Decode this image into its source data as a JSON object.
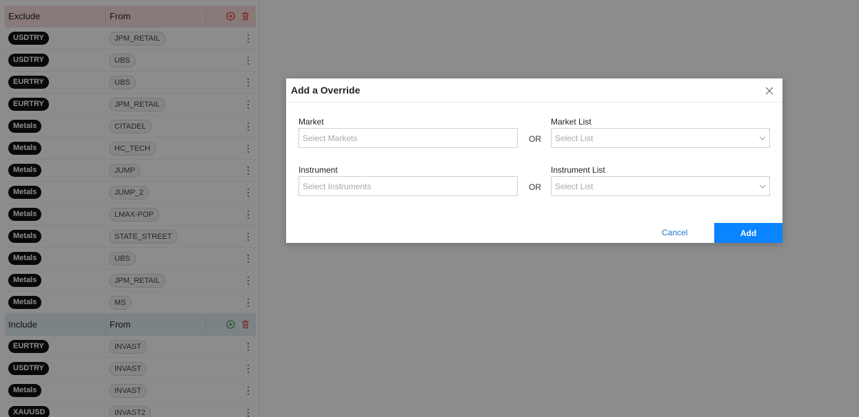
{
  "exclude_section": {
    "header": {
      "col1": "Exclude",
      "col2": "From"
    },
    "rows": [
      {
        "instrument": "USDTRY",
        "source": "JPM_RETAIL"
      },
      {
        "instrument": "USDTRY",
        "source": "UBS"
      },
      {
        "instrument": "EURTRY",
        "source": "UBS"
      },
      {
        "instrument": "EURTRY",
        "source": "JPM_RETAIL"
      },
      {
        "instrument": "Metals",
        "source": "CITADEL"
      },
      {
        "instrument": "Metals",
        "source": "HC_TECH"
      },
      {
        "instrument": "Metals",
        "source": "JUMP"
      },
      {
        "instrument": "Metals",
        "source": "JUMP_2"
      },
      {
        "instrument": "Metals",
        "source": "LMAX-POP"
      },
      {
        "instrument": "Metals",
        "source": "STATE_STREET"
      },
      {
        "instrument": "Metals",
        "source": "UBS"
      },
      {
        "instrument": "Metals",
        "source": "JPM_RETAIL"
      },
      {
        "instrument": "Metals",
        "source": "MS"
      }
    ]
  },
  "include_section": {
    "header": {
      "col1": "Include",
      "col2": "From"
    },
    "rows": [
      {
        "instrument": "EURTRY",
        "source": "INVAST"
      },
      {
        "instrument": "USDTRY",
        "source": "INVAST"
      },
      {
        "instrument": "Metals",
        "source": "INVAST"
      },
      {
        "instrument": "XAUUSD",
        "source": "INVAST2"
      }
    ]
  },
  "modal": {
    "title": "Add a Override",
    "market_label": "Market",
    "market_placeholder": "Select Markets",
    "or_text": "OR",
    "market_list_label": "Market List",
    "market_list_placeholder": "Select List",
    "instrument_label": "Instrument",
    "instrument_placeholder": "Select Instruments",
    "instrument_list_label": "Instrument List",
    "instrument_list_placeholder": "Select List",
    "cancel_label": "Cancel",
    "add_label": "Add"
  },
  "icons": {
    "add": "plus-circle-icon",
    "delete": "trash-icon",
    "row_menu": "kebab-menu-icon",
    "close": "close-icon",
    "dropdown": "chevron-down-icon"
  },
  "colors": {
    "exclude_header_bg": "#f8dede",
    "include_header_bg": "#e0eef5",
    "exclude_add_icon": "#e53935",
    "include_add_icon": "#43a047",
    "delete_icon": "#e53935",
    "primary_button": "#0a84ff",
    "link": "#1a73c9"
  }
}
